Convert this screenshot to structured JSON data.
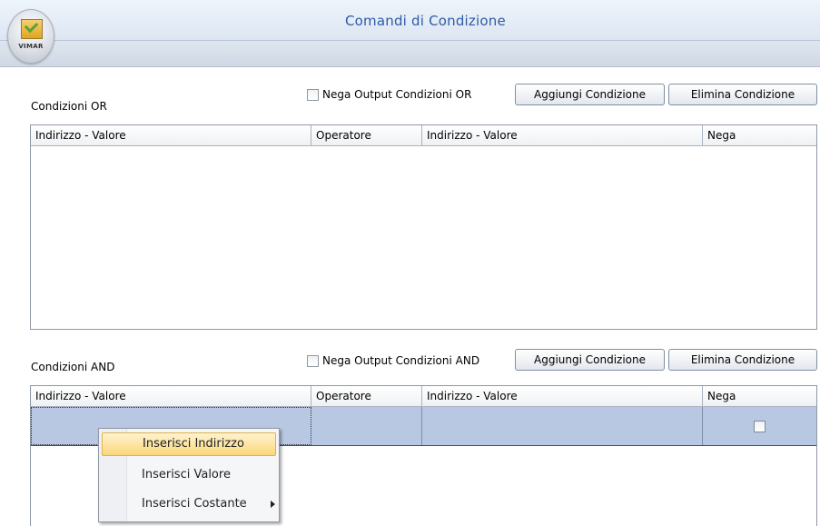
{
  "window": {
    "title": "Comandi di Condizione",
    "brand": "VIMAR"
  },
  "or_section": {
    "label": "Condizioni OR",
    "negate_label": "Nega Output Condizioni OR",
    "negate_checked": false,
    "add_button": "Aggiungi Condizione",
    "remove_button": "Elimina Condizione",
    "columns": [
      "Indirizzo - Valore",
      "Operatore",
      "Indirizzo - Valore",
      "Nega"
    ],
    "rows": []
  },
  "and_section": {
    "label": "Condizioni AND",
    "negate_label": "Nega Output Condizioni AND",
    "negate_checked": false,
    "add_button": "Aggiungi Condizione",
    "remove_button": "Elimina Condizione",
    "columns": [
      "Indirizzo - Valore",
      "Operatore",
      "Indirizzo - Valore",
      "Nega"
    ],
    "rows": [
      {
        "address_value_1": "",
        "operator": "",
        "address_value_2": "",
        "negate": false
      }
    ]
  },
  "context_menu": {
    "items": [
      "Inserisci Indirizzo",
      "Inserisci Valore",
      "Inserisci Costante"
    ],
    "highlighted": "Inserisci Indirizzo",
    "submenu_item": "Inserisci Costante"
  },
  "colors": {
    "title_text": "#2f5aa8",
    "selected_row": "#b8c8e3",
    "menu_highlight": "#fbd77a"
  },
  "icons": {
    "logo": "vimar-logo-icon",
    "submenu": "chevron-right-icon"
  }
}
